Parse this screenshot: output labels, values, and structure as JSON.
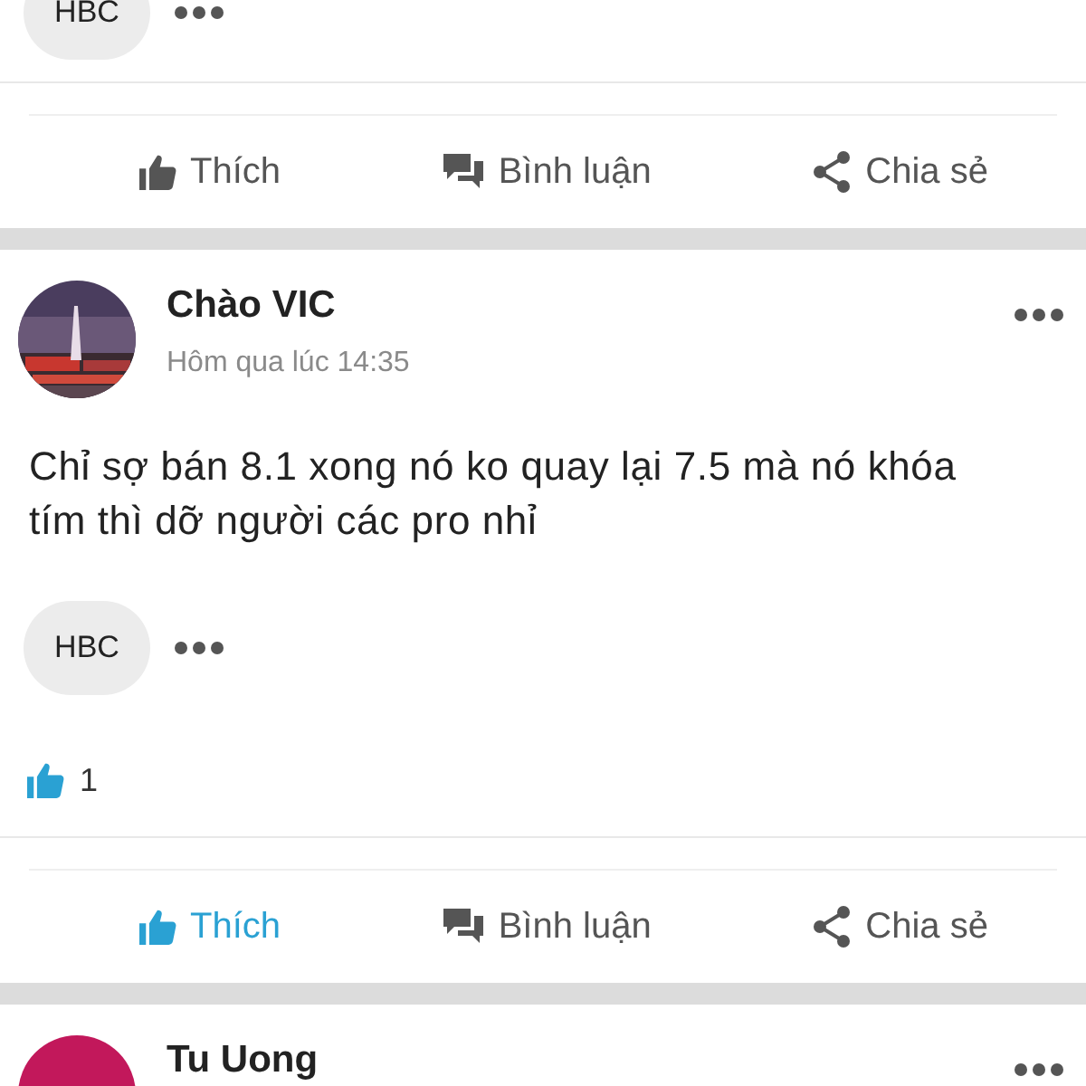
{
  "posts": [
    {
      "chip": "HBC",
      "actions": [
        {
          "kind": "like",
          "label": "Thích",
          "selected": false
        },
        {
          "kind": "comment",
          "label": "Bình luận",
          "selected": false
        },
        {
          "kind": "share",
          "label": "Chia sẻ",
          "selected": false
        }
      ]
    },
    {
      "author": "Chào VIC",
      "time": "Hôm qua lúc 14:35",
      "text": "Chỉ sợ bán 8.1 xong nó ko quay lại 7.5 mà nó khóa tím thì dỡ người các pro nhỉ",
      "chip": "HBC",
      "likes": "1",
      "actions": [
        {
          "kind": "like",
          "label": "Thích",
          "selected": true
        },
        {
          "kind": "comment",
          "label": "Bình luận",
          "selected": false
        },
        {
          "kind": "share",
          "label": "Chia sẻ",
          "selected": false
        }
      ]
    },
    {
      "author": "Tu Uong",
      "avatar": {
        "kind": "plain"
      }
    }
  ]
}
